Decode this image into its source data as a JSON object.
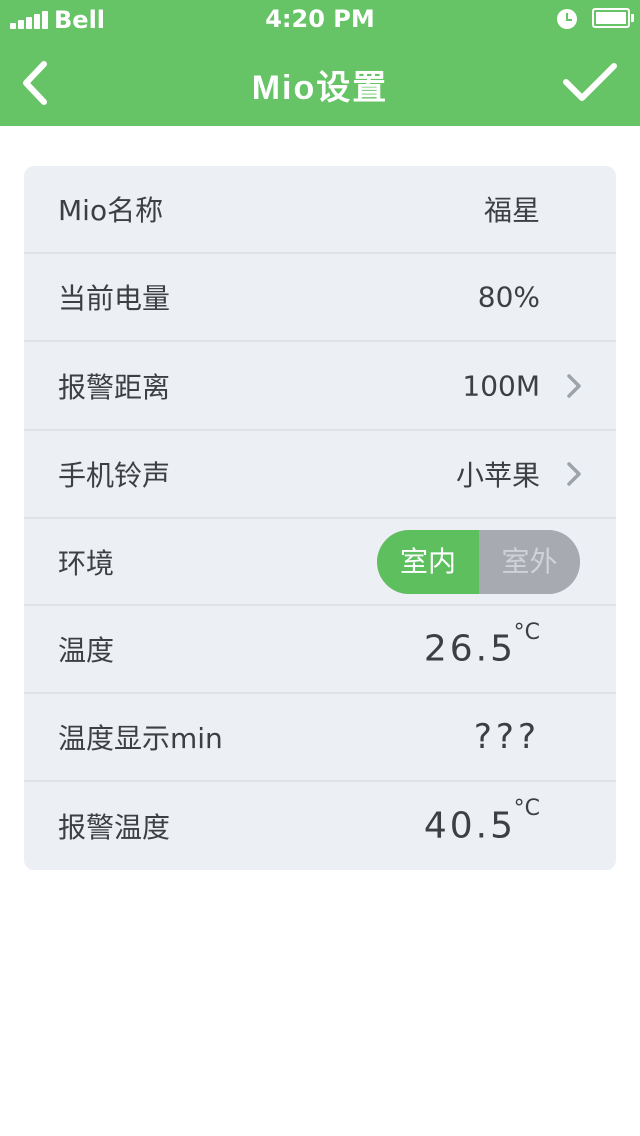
{
  "status_bar": {
    "carrier": "Bell",
    "time": "4:20 PM"
  },
  "nav": {
    "title": "Mio设置",
    "back_icon": "chevron-left-icon",
    "confirm_icon": "checkmark-icon"
  },
  "settings": {
    "name": {
      "label": "Mio名称",
      "value": "福星"
    },
    "battery": {
      "label": "当前电量",
      "value": "80%"
    },
    "alarm_distance": {
      "label": "报警距离",
      "value": "100M"
    },
    "ringtone": {
      "label": "手机铃声",
      "value": "小苹果"
    },
    "environment": {
      "label": "环境",
      "option_on": "室内",
      "option_off": "室外",
      "selected": "室内"
    },
    "temperature": {
      "label": "温度",
      "value": "26.5",
      "unit": "°C"
    },
    "temp_display_min": {
      "label": "温度显示min",
      "value": "???"
    },
    "alarm_temperature": {
      "label": "报警温度",
      "value": "40.5",
      "unit": "°C"
    }
  },
  "colors": {
    "brand_green": "#66c466",
    "panel_bg": "#eceff3",
    "toggle_off": "#a7abb1"
  }
}
